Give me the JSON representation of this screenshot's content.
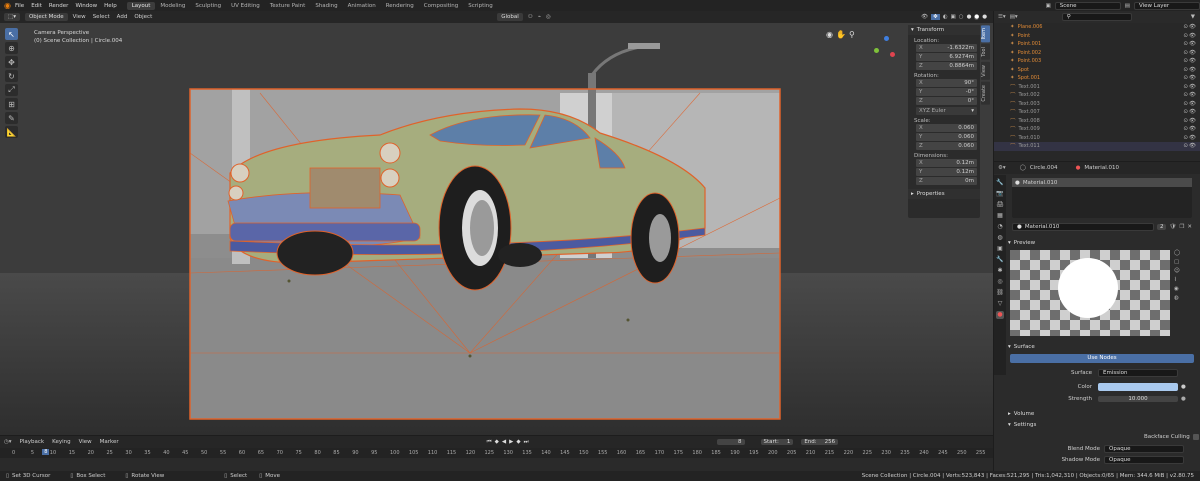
{
  "topbar": {
    "menus": [
      "File",
      "Edit",
      "Render",
      "Window",
      "Help"
    ],
    "workspaces": [
      "Layout",
      "Modeling",
      "Sculpting",
      "UV Editing",
      "Texture Paint",
      "Shading",
      "Animation",
      "Rendering",
      "Compositing",
      "Scripting"
    ],
    "active_workspace": "Layout",
    "scene": "Scene",
    "view_layer": "View Layer"
  },
  "viewport_header": {
    "mode": "Object Mode",
    "menus": [
      "View",
      "Select",
      "Add",
      "Object"
    ],
    "orientation": "Global"
  },
  "viewport": {
    "perspective": "Camera Perspective",
    "collection": "(0) Scene Collection | Circle.004"
  },
  "npanel": {
    "tabs": [
      "Item",
      "Tool",
      "View",
      "Create"
    ],
    "transform_title": "Transform",
    "location_label": "Location:",
    "location": [
      {
        "axis": "X",
        "value": "-1.6322m"
      },
      {
        "axis": "Y",
        "value": "6.9274m"
      },
      {
        "axis": "Z",
        "value": "0.8864m"
      }
    ],
    "rotation_label": "Rotation:",
    "rotation": [
      {
        "axis": "X",
        "value": "90°"
      },
      {
        "axis": "Y",
        "value": "-0°"
      },
      {
        "axis": "Z",
        "value": "0°"
      }
    ],
    "euler": "XYZ Euler",
    "scale_label": "Scale:",
    "scale": [
      {
        "axis": "X",
        "value": "0.060"
      },
      {
        "axis": "Y",
        "value": "0.060"
      },
      {
        "axis": "Z",
        "value": "0.060"
      }
    ],
    "dimensions_label": "Dimensions:",
    "dimensions": [
      {
        "axis": "X",
        "value": "0.12m"
      },
      {
        "axis": "Y",
        "value": "0.12m"
      },
      {
        "axis": "Z",
        "value": "0m"
      }
    ],
    "properties_title": "Properties"
  },
  "outliner": {
    "items": [
      {
        "name": "Plane.006",
        "orange": true
      },
      {
        "name": "Point",
        "orange": true
      },
      {
        "name": "Point.001",
        "orange": true
      },
      {
        "name": "Point.002",
        "orange": true
      },
      {
        "name": "Point.003",
        "orange": true
      },
      {
        "name": "Spot",
        "orange": true
      },
      {
        "name": "Spot.001",
        "orange": true
      },
      {
        "name": "Text.001",
        "orange": false
      },
      {
        "name": "Text.002",
        "orange": false
      },
      {
        "name": "Text.003",
        "orange": false
      },
      {
        "name": "Text.007",
        "orange": false
      },
      {
        "name": "Text.008",
        "orange": false
      },
      {
        "name": "Text.009",
        "orange": false
      },
      {
        "name": "Text.010",
        "orange": false
      },
      {
        "name": "Text.011",
        "orange": false
      }
    ]
  },
  "properties": {
    "object_name": "Circle.004",
    "material_name": "Material.010",
    "slot_name": "Material.010",
    "material_field": "Material.010",
    "users": "2",
    "preview_label": "Preview",
    "surface_label": "Surface",
    "use_nodes": "Use Nodes",
    "surface_field_label": "Surface",
    "surface_value": "Emission",
    "color_label": "Color",
    "color_value": "#a9c9ee",
    "strength_label": "Strength",
    "strength_value": "10.000",
    "volume_label": "Volume",
    "settings_label": "Settings",
    "backface_label": "Backface Culling",
    "blend_label": "Blend Mode",
    "blend_value": "Opaque",
    "shadow_label": "Shadow Mode",
    "shadow_value": "Opaque"
  },
  "timeline": {
    "menus": [
      "Playback",
      "Keying",
      "View",
      "Marker"
    ],
    "current_frame": "8",
    "start_label": "Start:",
    "start": "1",
    "end_label": "End:",
    "end": "256",
    "ruler": [
      "0",
      "5",
      "8",
      "10",
      "15",
      "20",
      "25",
      "30",
      "35",
      "40",
      "45",
      "50",
      "55",
      "60",
      "65",
      "70",
      "75",
      "80",
      "85",
      "90",
      "95",
      "100",
      "105",
      "110",
      "115",
      "120",
      "125",
      "130",
      "135",
      "140",
      "145",
      "150",
      "155",
      "160",
      "165",
      "170",
      "175",
      "180",
      "185",
      "190",
      "195",
      "200",
      "205",
      "210",
      "215",
      "220",
      "225",
      "230",
      "235",
      "240",
      "245",
      "250",
      "255"
    ]
  },
  "status": {
    "left": "Set 3D Cursor",
    "box": "Box Select",
    "rotate": "Rotate View",
    "select": "Select",
    "move": "Move",
    "stats": "Scene Collection | Circle.004 | Verts:523,843 | Faces:521,295 | Tris:1,042,310 | Objects:0/65 | Mem: 344.6 MiB | v2.80.75"
  }
}
